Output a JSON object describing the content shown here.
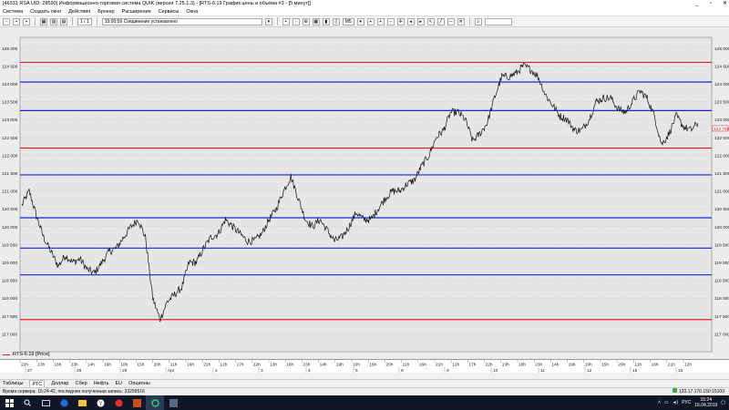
{
  "window": {
    "title": "[46331 RSA UID: 28590] Информационно-торговая система QUIK (версия 7.25.1.3) - [RTS-6.19 График цены и объёма #3 - [5 минут]]",
    "controls": [
      "_",
      "▫",
      "✕"
    ]
  },
  "menu": [
    "Система",
    "Создать окно",
    "Действия",
    "Брокер",
    "Расширения",
    "Сервисы",
    "Окна"
  ],
  "toolbar": {
    "page_indicator": "1 / 1",
    "connection_status": "15:00:59 Соединение установлено",
    "interval": "M5"
  },
  "chart": {
    "instrument_legend": "RTS-6.19 [Price]",
    "price_labels": [
      "125 000",
      "124 500",
      "124 000",
      "123 500",
      "123 000",
      "122 500",
      "122 000",
      "121 500",
      "121 000",
      "120 500",
      "120 000",
      "119 500",
      "119 000",
      "118 500",
      "118 000",
      "117 500",
      "117 000"
    ],
    "current_price": "122 750",
    "time_labels": [
      "22h",
      "13h",
      "18h",
      "23h",
      "14h",
      "19h",
      "10h",
      "15h",
      "20h",
      "11h",
      "16h",
      "21h",
      "12h",
      "17h",
      "22h",
      "13h",
      "18h",
      "23h",
      "14h",
      "19h",
      "10h",
      "15h",
      "20h",
      "11h",
      "16h",
      "21h",
      "12h",
      "17h",
      "22h",
      "13h",
      "18h",
      "23h",
      "14h",
      "19h",
      "10h",
      "15h",
      "20h",
      "11h",
      "16h",
      "21h",
      "12h"
    ],
    "date_labels": [
      "27",
      "28",
      "29",
      "Apr",
      "2",
      "3",
      "4",
      "5",
      "8",
      "9",
      "10",
      "11",
      "12",
      "15",
      "16"
    ],
    "line_colors": {
      "red": "#e02020",
      "blue": "#2020e0"
    }
  },
  "chart_data": {
    "type": "line",
    "ylim": [
      116500,
      125300
    ],
    "grid": true,
    "horizontal_levels": [
      {
        "value": 124600,
        "color": "red"
      },
      {
        "value": 124050,
        "color": "blue"
      },
      {
        "value": 123250,
        "color": "blue"
      },
      {
        "value": 122200,
        "color": "red"
      },
      {
        "value": 121450,
        "color": "blue"
      },
      {
        "value": 120250,
        "color": "blue"
      },
      {
        "value": 119400,
        "color": "blue"
      },
      {
        "value": 118650,
        "color": "blue"
      },
      {
        "value": 117400,
        "color": "red"
      }
    ],
    "series": [
      {
        "values": [
          120600,
          121000,
          120300,
          119700,
          119300,
          118900,
          119200,
          119000,
          119100,
          118800,
          118700,
          119000,
          119300,
          119400,
          119700,
          120000,
          120200,
          119700,
          118000,
          117400,
          117900,
          118100,
          118300,
          119000,
          119000,
          119400,
          119700,
          119800,
          120200,
          120000,
          119800,
          119600,
          119600,
          119800,
          120200,
          120500,
          121000,
          121400,
          120800,
          120200,
          120000,
          120200,
          119900,
          119600,
          119700,
          120000,
          120400,
          120200,
          120200,
          120500,
          120800,
          121000,
          121000,
          121200,
          121300,
          121700,
          122000,
          122500,
          122700,
          123200,
          123200,
          123000,
          122400,
          122600,
          122900,
          123600,
          124200,
          124200,
          124300,
          124500,
          124400,
          124200,
          123700,
          123400,
          123100,
          123000,
          122700,
          122700,
          123000,
          123500,
          123600,
          123600,
          123300,
          123200,
          123500,
          123800,
          123600,
          123100,
          122300,
          122600,
          123100,
          122800,
          122700,
          122900
        ]
      }
    ]
  },
  "bottom_tabs": [
    "Таблицы",
    "РТС",
    "Доллар",
    "Сбер",
    "Нефть",
    "EU",
    "Опционы"
  ],
  "active_tab": "РТС",
  "statusbar": {
    "server_time": "Время сервера: 15:24:42, последняя полученная запись: 33299516",
    "ip": "193.17.170.150:15100"
  },
  "taskbar": {
    "lang": "РУС",
    "time": "15:24",
    "date": "16.04.2019"
  }
}
